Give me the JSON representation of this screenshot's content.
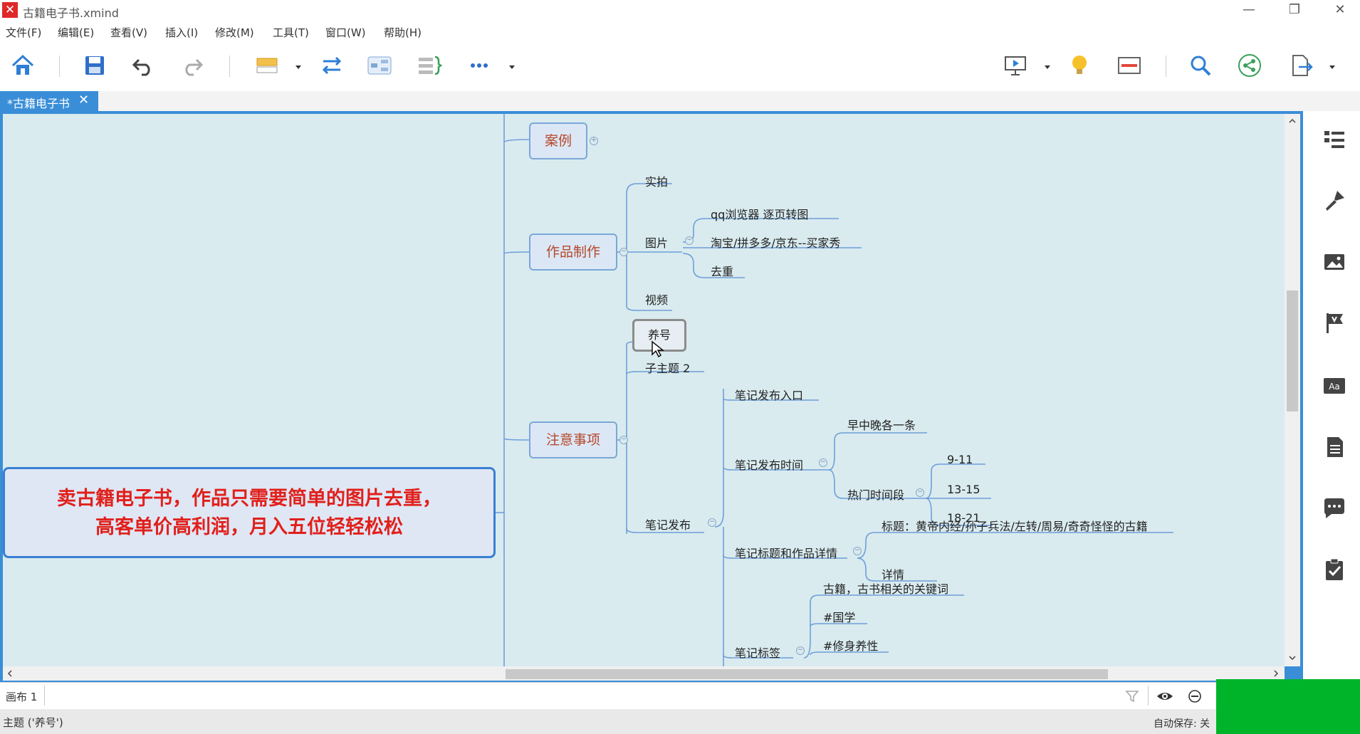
{
  "window": {
    "title": "古籍电子书.xmind",
    "minimize": "—",
    "restore": "❐",
    "close": "✕"
  },
  "menu": [
    "文件(F)",
    "编辑(E)",
    "查看(V)",
    "插入(I)",
    "修改(M)",
    "工具(T)",
    "窗口(W)",
    "帮助(H)"
  ],
  "toolbar_icons": [
    "home-icon",
    "save-icon",
    "undo-icon",
    "redo-icon",
    "topic-icon",
    "relationship-icon",
    "boundary-icon",
    "summary-icon",
    "more-icon",
    "presentation-icon",
    "idea-icon",
    "outline-icon",
    "search-icon",
    "share-icon",
    "export-icon"
  ],
  "tab": {
    "label": "*古籍电子书",
    "close": "✕"
  },
  "mindmap": {
    "case": "案例",
    "production": "作品制作",
    "shoot": "实拍",
    "image": "图片",
    "qq": "qq浏览器 逐页转图",
    "shops": "淘宝/拼多多/京东--买家秀",
    "dedupe": "去重",
    "video": "视频",
    "notes": "注意事项",
    "nurture": "养号",
    "subtopic2": "子主题 2",
    "publish": "笔记发布",
    "entry": "笔记发布入口",
    "time": "笔记发布时间",
    "daily": "早中晚各一条",
    "hot": "热门时间段",
    "t1": "9-11",
    "t2": "13-15",
    "t3": "18-21",
    "titledetail": "笔记标题和作品详情",
    "titletext": "标题：黄帝内经/孙子兵法/左转/周易/奇奇怪怪的古籍",
    "detail": "详情",
    "tags": "笔记标签",
    "tagkw": "古籍，古书相关的关键词",
    "tag1": "#国学",
    "tag2": "#修身养性"
  },
  "callout": {
    "line1": "卖古籍电子书，作品只需要简单的图片去重，",
    "line2": "高客单价高利润，月入五位轻轻松松"
  },
  "sheet": {
    "label": "画布 1"
  },
  "status": {
    "left": "主题 ('养号')",
    "right": "自动保存: 关"
  },
  "colors": {
    "accent": "#3a8ed8",
    "canvas": "#d9ebef",
    "main_topic_text": "#b5472a",
    "callout_text": "#e1201b",
    "branch_line": "#6f9ed9",
    "green_block": "#00b42a"
  }
}
